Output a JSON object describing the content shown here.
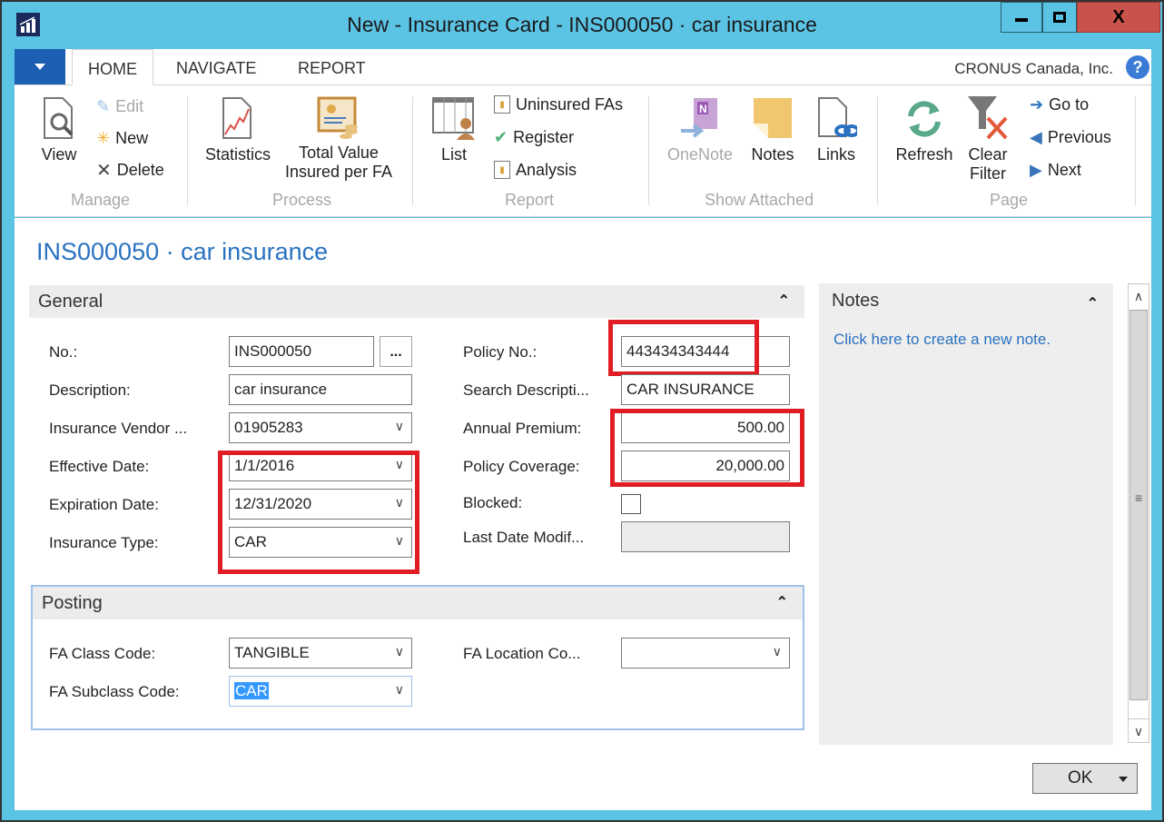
{
  "window": {
    "title": "New - Insurance Card - INS000050 · car insurance",
    "controls": {
      "minimize": "minimize",
      "maximize": "maximize",
      "close": "X"
    }
  },
  "ribbon_tabs": {
    "items": [
      "HOME",
      "NAVIGATE",
      "REPORT"
    ],
    "active": "HOME",
    "company": "CRONUS Canada, Inc.",
    "help": "?"
  },
  "ribbon": {
    "manage": {
      "label": "Manage",
      "view": "View",
      "edit": "Edit",
      "new": "New",
      "delete": "Delete"
    },
    "process": {
      "label": "Process",
      "statistics": "Statistics",
      "total_value_line1": "Total Value",
      "total_value_line2": "Insured per FA"
    },
    "report": {
      "label": "Report",
      "list": "List",
      "uninsured": "Uninsured FAs",
      "register": "Register",
      "analysis": "Analysis"
    },
    "show_attached": {
      "label": "Show Attached",
      "onenote": "OneNote",
      "notes": "Notes",
      "links": "Links"
    },
    "page": {
      "label": "Page",
      "refresh": "Refresh",
      "clear_filter_line1": "Clear",
      "clear_filter_line2": "Filter",
      "goto": "Go to",
      "previous": "Previous",
      "next": "Next"
    }
  },
  "page": {
    "title": "INS000050 · car insurance"
  },
  "general": {
    "header": "General",
    "left_fields": [
      {
        "label": "No.:",
        "value": "INS000050"
      },
      {
        "label": "Description:",
        "value": "car insurance"
      },
      {
        "label": "Insurance Vendor ...",
        "value": "01905283"
      },
      {
        "label": "Effective Date:",
        "value": "1/1/2016"
      },
      {
        "label": "Expiration Date:",
        "value": "12/31/2020"
      },
      {
        "label": "Insurance Type:",
        "value": "CAR"
      }
    ],
    "right_fields": [
      {
        "label": "Policy No.:",
        "value": "443434343444"
      },
      {
        "label": "Search Descripti...",
        "value": "CAR INSURANCE"
      },
      {
        "label": "Annual Premium:",
        "value": "500.00"
      },
      {
        "label": "Policy Coverage:",
        "value": "20,000.00"
      },
      {
        "label": "Blocked:",
        "value": false
      },
      {
        "label": "Last Date Modif...",
        "value": ""
      }
    ],
    "ellipsis": "..."
  },
  "posting": {
    "header": "Posting",
    "fields": [
      {
        "label": "FA Class Code:",
        "value": "TANGIBLE"
      },
      {
        "label": "FA Subclass Code:",
        "value": "CAR"
      },
      {
        "label": "FA Location Co...",
        "value": ""
      }
    ]
  },
  "notes": {
    "header": "Notes",
    "link": "Click here to create a new note."
  },
  "footer": {
    "ok": "OK"
  },
  "colors": {
    "titlebar": "#5bc4e5",
    "accent_blue": "#2a72c0",
    "highlight_red": "#e01c24",
    "close_button": "#c9534b"
  }
}
